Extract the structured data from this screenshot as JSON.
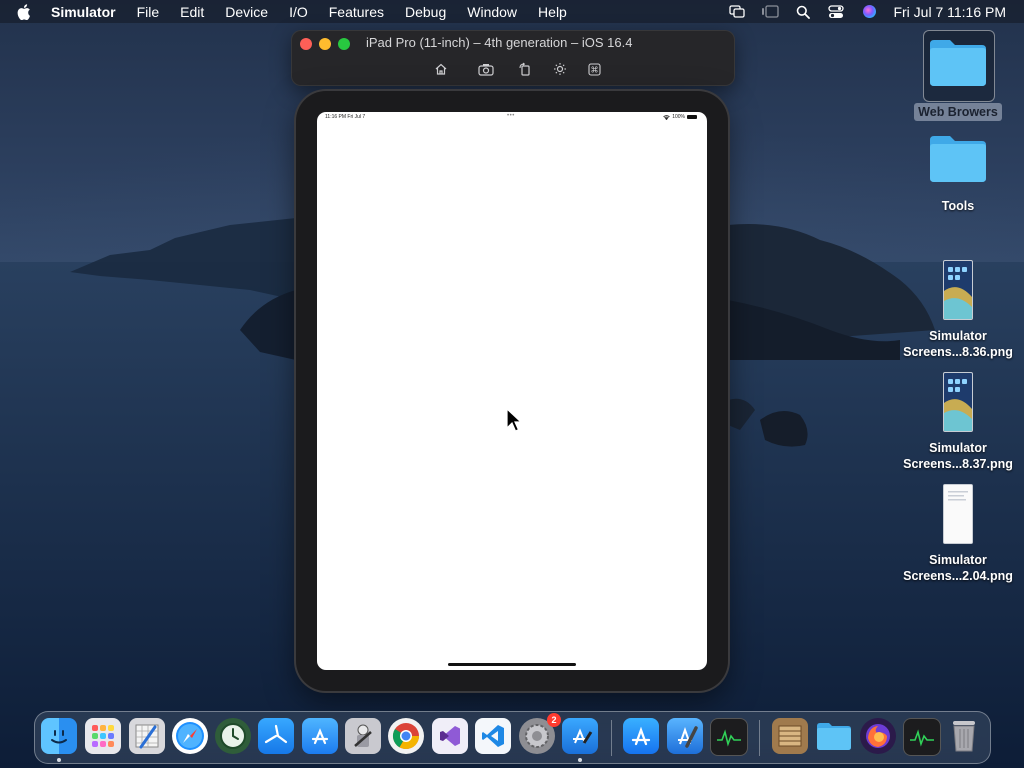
{
  "menubar": {
    "app_name": "Simulator",
    "items": [
      "File",
      "Edit",
      "Device",
      "I/O",
      "Features",
      "Debug",
      "Window",
      "Help"
    ],
    "clock": "Fri Jul 7  11:16 PM"
  },
  "simulator": {
    "window_title": "iPad Pro (11-inch) – 4th generation – iOS 16.4",
    "tools": [
      "home-icon",
      "screenshot-icon",
      "rotate-icon",
      "brightness-icon",
      "keyboard-shortcut-icon"
    ]
  },
  "ipad": {
    "status_time": "11:16 PM   Fri Jul 7",
    "status_dots": "•••",
    "battery_text": "100%"
  },
  "desktop": {
    "icons": [
      {
        "label": "Web Browers",
        "type": "folder"
      },
      {
        "label": "Tools",
        "type": "folder"
      },
      {
        "label_line1": "Simulator",
        "label_line2": "Screens...8.36.png",
        "type": "screenshot"
      },
      {
        "label_line1": "Simulator",
        "label_line2": "Screens...8.37.png",
        "type": "screenshot"
      },
      {
        "label_line1": "Simulator",
        "label_line2": "Screens...2.04.png",
        "type": "document"
      }
    ]
  },
  "dock": {
    "apps": [
      "Finder",
      "Launchpad",
      "Script Editor",
      "Safari",
      "Time Machine",
      "Simulator",
      "App Store Connect",
      "Automator",
      "Google Chrome",
      "Visual Studio",
      "Visual Studio Code",
      "System Settings",
      "Xcode Simulator",
      "App Store",
      "Xcode",
      "Activity Monitor",
      "Archive",
      "Folder",
      "Firefox",
      "Activity Monitor 2",
      "Trash"
    ],
    "settings_badge": "2"
  }
}
